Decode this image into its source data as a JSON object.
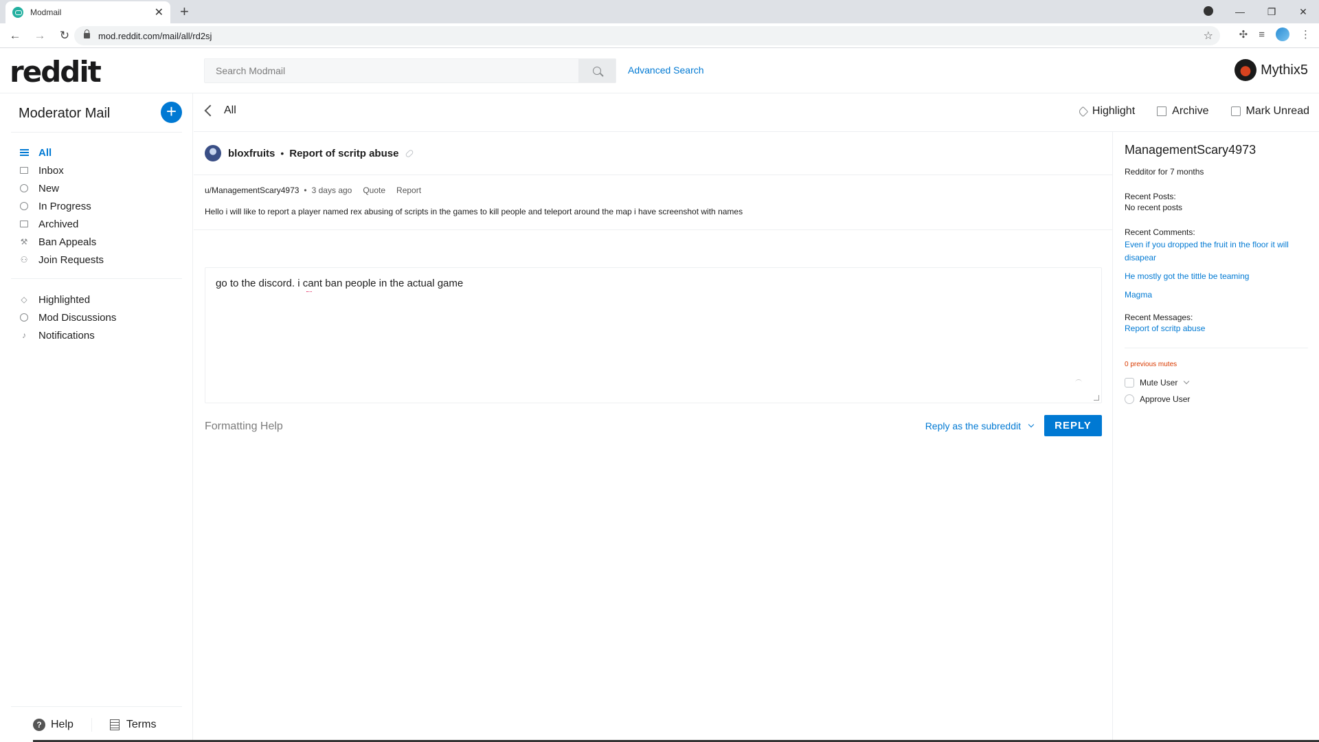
{
  "browser": {
    "tab_title": "Modmail",
    "url": "mod.reddit.com/mail/all/rd2sj",
    "icons": [
      "back-icon",
      "forward-icon",
      "reload-icon",
      "lock-icon",
      "star-icon",
      "extensions-icon",
      "media-icon",
      "profile-icon",
      "menu-icon"
    ]
  },
  "header": {
    "logo": "reddit",
    "search_placeholder": "Search Modmail",
    "advanced_search": "Advanced Search",
    "username": "Mythix5"
  },
  "sidebar": {
    "title": "Moderator Mail",
    "new_button": "+",
    "primary": [
      {
        "label": "All",
        "icon": "list-icon",
        "active": true
      },
      {
        "label": "Inbox",
        "icon": "inbox-icon"
      },
      {
        "label": "New",
        "icon": "new-icon"
      },
      {
        "label": "In Progress",
        "icon": "clock-icon"
      },
      {
        "label": "Archived",
        "icon": "archive-icon"
      },
      {
        "label": "Ban Appeals",
        "icon": "hammer-icon"
      },
      {
        "label": "Join Requests",
        "icon": "user-add-icon"
      }
    ],
    "secondary": [
      {
        "label": "Highlighted",
        "icon": "tag-icon"
      },
      {
        "label": "Mod Discussions",
        "icon": "shield-icon"
      },
      {
        "label": "Notifications",
        "icon": "bell-icon"
      }
    ],
    "footer": {
      "help": "Help",
      "terms": "Terms"
    }
  },
  "toolbar": {
    "back_label": "All",
    "highlight": "Highlight",
    "archive": "Archive",
    "mark_unread": "Mark Unread"
  },
  "conversation": {
    "subreddit": "bloxfruits",
    "separator": "•",
    "subject": "Report of scritp abuse",
    "message": {
      "author": "u/ManagementScary4973",
      "separator": "•",
      "time": "3 days ago",
      "quote": "Quote",
      "report": "Report",
      "body": "Hello i will like to report a player named rex abusing of scripts in the games to kill people and teleport around the map i have screenshot with names"
    },
    "reply": {
      "text": "go to the discord. i cant ban people in the actual game",
      "formatting_help": "Formatting Help",
      "reply_as": "Reply as the subreddit",
      "reply_button": "REPLY"
    }
  },
  "user_panel": {
    "name": "ManagementScary4973",
    "age": "Redditor for 7 months",
    "recent_posts_label": "Recent Posts:",
    "recent_posts_value": "No recent posts",
    "recent_comments_label": "Recent Comments:",
    "recent_comments": [
      "Even if you dropped the fruit in the floor it will disapear",
      "He mostly got the tittle be teaming",
      "Magma"
    ],
    "recent_messages_label": "Recent Messages:",
    "recent_messages": [
      "Report of scritp abuse"
    ],
    "previous_mutes": "0 previous mutes",
    "mute_user": "Mute User",
    "approve_user": "Approve User"
  },
  "colors": {
    "accent": "#0079d3",
    "mutes": "#d93a00"
  }
}
